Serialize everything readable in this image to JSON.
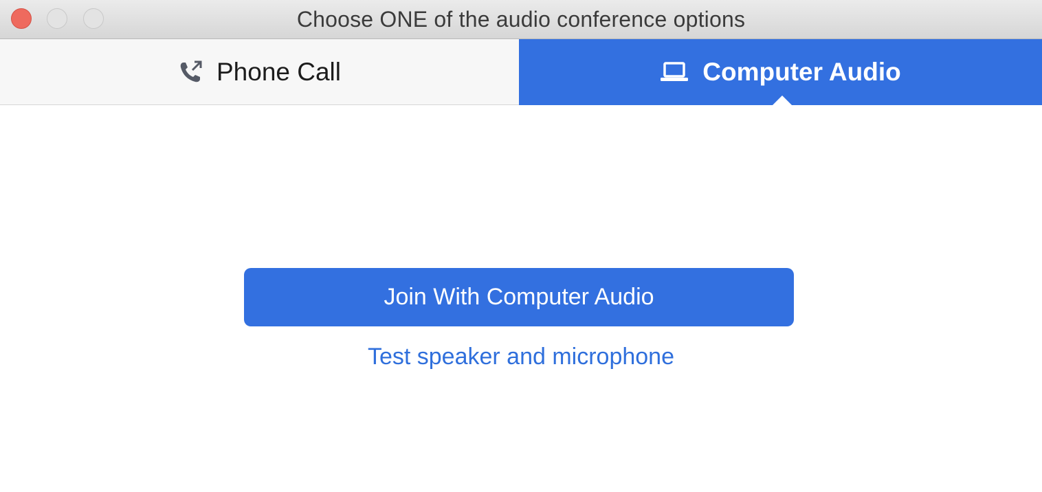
{
  "window": {
    "title": "Choose ONE of the audio conference options"
  },
  "tabs": [
    {
      "label": "Phone Call",
      "icon": "phone-icon",
      "selected": false
    },
    {
      "label": "Computer Audio",
      "icon": "laptop-icon",
      "selected": true
    }
  ],
  "main": {
    "join_button_label": "Join With Computer Audio",
    "test_link_label": "Test speaker and microphone"
  },
  "colors": {
    "accent": "#3370e0",
    "link": "#2f6fdc",
    "close_button": "#ee6a5e"
  }
}
